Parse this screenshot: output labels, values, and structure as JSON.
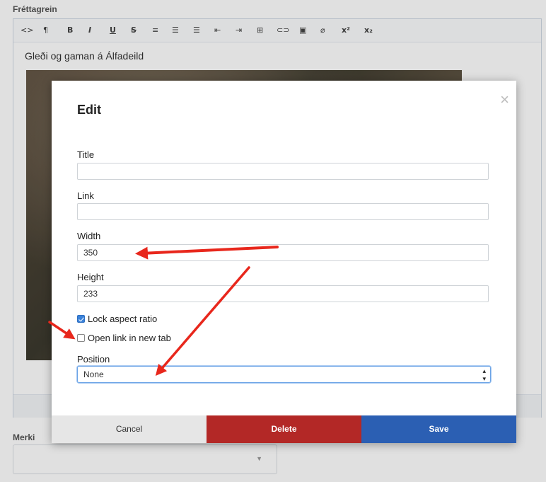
{
  "background": {
    "editor_label": "Fréttagrein",
    "editor_text": "Gleði og gaman á Álfadeild",
    "tags_label": "Merki",
    "tags_caret": "▼",
    "toolbar": [
      "<>",
      "¶",
      "B",
      "I",
      "U",
      "S",
      "≡",
      "☰",
      "☰",
      "⇤",
      "⇥",
      "⊞",
      "⊂⊃",
      "▣",
      "⌀",
      "x²",
      "x₂"
    ]
  },
  "modal": {
    "title": "Edit",
    "close": "×",
    "fields": {
      "title_label": "Title",
      "title_value": "",
      "link_label": "Link",
      "link_value": "",
      "width_label": "Width",
      "width_value": "350",
      "height_label": "Height",
      "height_value": "233"
    },
    "lock_aspect_label": "Lock aspect ratio",
    "lock_aspect_checked": true,
    "open_new_tab_label": "Open link in new tab",
    "open_new_tab_checked": false,
    "position_label": "Position",
    "position_value": "None",
    "buttons": {
      "cancel": "Cancel",
      "delete": "Delete",
      "save": "Save"
    }
  },
  "colors": {
    "delete": "#b32826",
    "save": "#2b5fb3",
    "arrow": "#e8271c",
    "checkbox": "#3b82d9"
  }
}
